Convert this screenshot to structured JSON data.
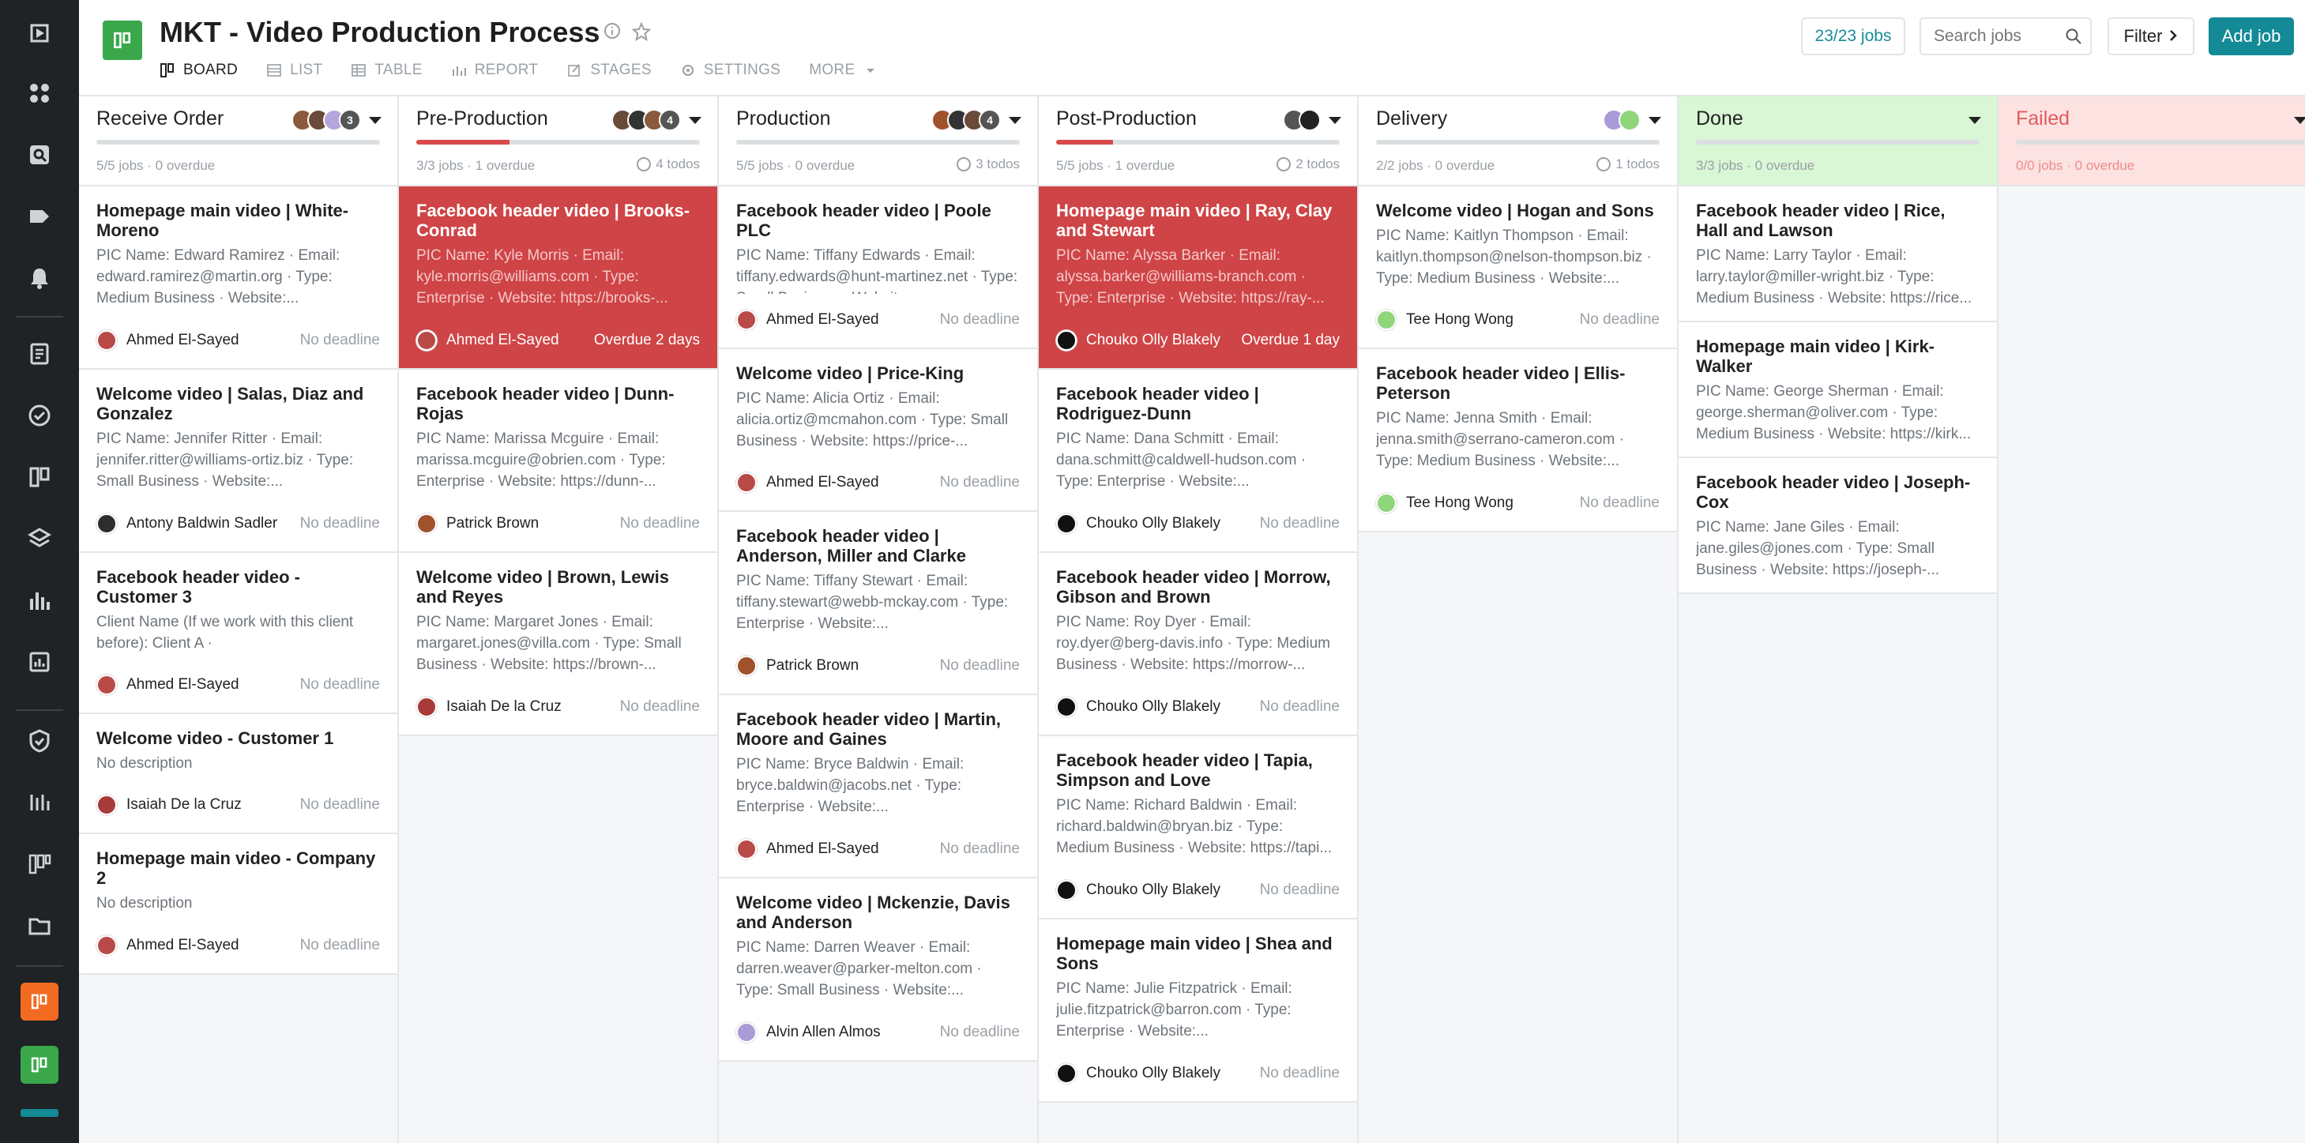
{
  "app": {
    "title": "MKT - Video Production Process",
    "tabs": [
      "BOARD",
      "LIST",
      "TABLE",
      "REPORT",
      "STAGES",
      "SETTINGS",
      "MORE"
    ],
    "active_tab": "BOARD",
    "jobs_count": "23/23 jobs",
    "search_placeholder": "Search jobs",
    "filter_label": "Filter",
    "add_job_label": "Add job"
  },
  "colors": {
    "accent": "#138a96",
    "overdue": "#cf4446",
    "done_bg": "#d9f6d5",
    "failed_bg": "#fde2e2",
    "sidebar_bg": "#1f2326"
  },
  "sidebar": {
    "icons": [
      "logo-icon",
      "dashboard-icon",
      "search-icon",
      "tag-icon",
      "bell-icon",
      "document-icon",
      "check-circle-icon",
      "board-icon",
      "layers-icon",
      "bar-chart-icon",
      "report-icon",
      "shield-icon",
      "timeline-icon",
      "kanban-icon",
      "folder-icon",
      "orange-app-icon",
      "green-app-icon"
    ]
  },
  "columns": [
    {
      "title": "Receive Order",
      "avatar_count": "3",
      "meta": "5/5 jobs · 0 overdue",
      "todos": "",
      "cards": [
        {
          "title": "Homepage main video | White-Moreno",
          "desc": "PIC Name: Edward Ramirez · Email: edward.ramirez@martin.org · Type: Medium Business · Website:...",
          "person": "Ahmed El-Sayed",
          "due": "No deadline"
        },
        {
          "title": "Welcome video | Salas, Diaz and Gonzalez",
          "desc": "PIC Name: Jennifer Ritter · Email: jennifer.ritter@williams-ortiz.biz · Type: Small Business · Website:...",
          "person": "Antony Baldwin Sadler",
          "due": "No deadline"
        },
        {
          "title": "Facebook header video - Customer 3",
          "desc": "Client Name (If we work with this client before): Client A ·",
          "person": "Ahmed El-Sayed",
          "due": "No deadline"
        },
        {
          "title": "Welcome video - Customer 1",
          "desc": "No description",
          "person": "Isaiah De la Cruz",
          "due": "No deadline"
        },
        {
          "title": "Homepage main video - Company 2",
          "desc": "No description",
          "person": "Ahmed El-Sayed",
          "due": "No deadline"
        }
      ]
    },
    {
      "title": "Pre-Production",
      "avatar_count": "4",
      "meta": "3/3 jobs · 1 overdue",
      "todos": "4 todos",
      "cards": [
        {
          "title": "Facebook header video | Brooks-Conrad",
          "desc": "PIC Name: Kyle Morris · Email: kyle.morris@williams.com · Type: Enterprise · Website: https://brooks-...",
          "person": "Ahmed El-Sayed",
          "due": "Overdue 2 days"
        },
        {
          "title": "Facebook header video | Dunn-Rojas",
          "desc": "PIC Name: Marissa Mcguire · Email: marissa.mcguire@obrien.com · Type: Enterprise · Website: https://dunn-...",
          "person": "Patrick Brown",
          "due": "No deadline"
        },
        {
          "title": "Welcome video | Brown, Lewis and Reyes",
          "desc": "PIC Name: Margaret Jones · Email: margaret.jones@villa.com · Type: Small Business · Website: https://brown-...",
          "person": "Isaiah De la Cruz",
          "due": "No deadline"
        }
      ]
    },
    {
      "title": "Production",
      "avatar_count": "4",
      "meta": "5/5 jobs · 0 overdue",
      "todos": "3 todos",
      "cards": [
        {
          "title": "Facebook header video | Poole PLC",
          "desc": "PIC Name: Tiffany Edwards · Email: tiffany.edwards@hunt-martinez.net · Type: Small Business · Website:...",
          "person": "Ahmed El-Sayed",
          "due": "No deadline"
        },
        {
          "title": "Welcome video | Price-King",
          "desc": "PIC Name: Alicia Ortiz · Email: alicia.ortiz@mcmahon.com · Type: Small Business · Website: https://price-...",
          "person": "Ahmed El-Sayed",
          "due": "No deadline"
        },
        {
          "title": "Facebook header video | Anderson, Miller and Clarke",
          "desc": "PIC Name: Tiffany Stewart · Email: tiffany.stewart@webb-mckay.com · Type: Enterprise · Website:...",
          "person": "Patrick Brown",
          "due": "No deadline"
        },
        {
          "title": "Facebook header video | Martin, Moore and Gaines",
          "desc": "PIC Name: Bryce Baldwin · Email: bryce.baldwin@jacobs.net · Type: Enterprise · Website:...",
          "person": "Ahmed El-Sayed",
          "due": "No deadline"
        },
        {
          "title": "Welcome video | Mckenzie, Davis and Anderson",
          "desc": "PIC Name: Darren Weaver · Email: darren.weaver@parker-melton.com · Type: Small Business · Website:...",
          "person": "Alvin Allen Almos",
          "due": "No deadline"
        }
      ]
    },
    {
      "title": "Post-Production",
      "avatar_count": "",
      "meta": "5/5 jobs · 1 overdue",
      "todos": "2 todos",
      "cards": [
        {
          "title": "Homepage main video | Ray, Clay and Stewart",
          "desc": "PIC Name: Alyssa Barker · Email: alyssa.barker@williams-branch.com · Type: Enterprise · Website: https://ray-...",
          "person": "Chouko Olly Blakely",
          "due": "Overdue 1 day"
        },
        {
          "title": "Facebook header video | Rodriguez-Dunn",
          "desc": "PIC Name: Dana Schmitt · Email: dana.schmitt@caldwell-hudson.com · Type: Enterprise · Website:...",
          "person": "Chouko Olly Blakely",
          "due": "No deadline"
        },
        {
          "title": "Facebook header video | Morrow, Gibson and Brown",
          "desc": "PIC Name: Roy Dyer · Email: roy.dyer@berg-davis.info · Type: Medium Business · Website: https://morrow-...",
          "person": "Chouko Olly Blakely",
          "due": "No deadline"
        },
        {
          "title": "Facebook header video | Tapia, Simpson and Love",
          "desc": "PIC Name: Richard Baldwin · Email: richard.baldwin@bryan.biz · Type: Medium Business · Website: https://tapi...",
          "person": "Chouko Olly Blakely",
          "due": "No deadline"
        },
        {
          "title": "Homepage main video | Shea and Sons",
          "desc": "PIC Name: Julie Fitzpatrick · Email: julie.fitzpatrick@barron.com · Type: Enterprise · Website:...",
          "person": "Chouko Olly Blakely",
          "due": "No deadline"
        }
      ]
    },
    {
      "title": "Delivery",
      "avatar_count": "",
      "meta": "2/2 jobs · 0 overdue",
      "todos": "1 todos",
      "cards": [
        {
          "title": "Welcome video | Hogan and Sons",
          "desc": "PIC Name: Kaitlyn Thompson · Email: kaitlyn.thompson@nelson-thompson.biz · Type: Medium Business · Website:...",
          "person": "Tee Hong Wong",
          "due": "No deadline"
        },
        {
          "title": "Facebook header video | Ellis-Peterson",
          "desc": "PIC Name: Jenna Smith · Email: jenna.smith@serrano-cameron.com · Type: Medium Business · Website:...",
          "person": "Tee Hong Wong",
          "due": "No deadline"
        }
      ]
    },
    {
      "title": "Done",
      "avatar_count": "",
      "meta": "3/3 jobs · 0 overdue",
      "todos": "",
      "cards": [
        {
          "title": "Facebook header video | Rice, Hall and Lawson",
          "desc": "PIC Name: Larry Taylor · Email: larry.taylor@miller-wright.biz · Type: Medium Business · Website: https://rice...",
          "person": "",
          "due": ""
        },
        {
          "title": "Homepage main video | Kirk-Walker",
          "desc": "PIC Name: George Sherman · Email: george.sherman@oliver.com · Type: Medium Business · Website: https://kirk...",
          "person": "",
          "due": ""
        },
        {
          "title": "Facebook header video | Joseph-Cox",
          "desc": "PIC Name: Jane Giles · Email: jane.giles@jones.com · Type: Small Business · Website: https://joseph-...",
          "person": "",
          "due": ""
        }
      ]
    },
    {
      "title": "Failed",
      "avatar_count": "",
      "meta": "0/0 jobs · 0 overdue",
      "todos": "",
      "cards": []
    }
  ]
}
